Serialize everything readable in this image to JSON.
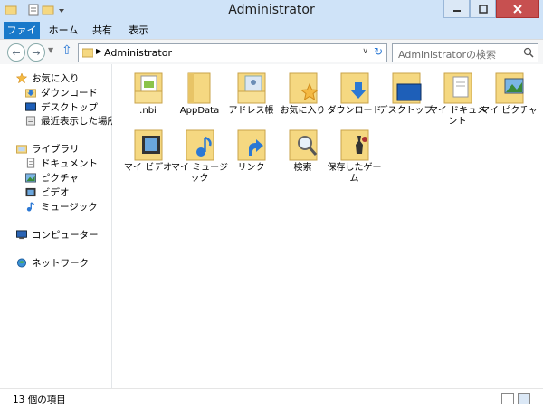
{
  "window": {
    "title": "Administrator"
  },
  "ribbon": {
    "tabs": [
      {
        "label": "ファイル"
      },
      {
        "label": "ホーム"
      },
      {
        "label": "共有"
      },
      {
        "label": "表示"
      }
    ]
  },
  "address": {
    "path": "Administrator"
  },
  "search": {
    "placeholder": "Administratorの検索"
  },
  "nav": {
    "favorites": {
      "label": "お気に入り",
      "items": [
        "ダウンロード",
        "デスクトップ",
        "最近表示した場所"
      ]
    },
    "libraries": {
      "label": "ライブラリ",
      "items": [
        "ドキュメント",
        "ピクチャ",
        "ビデオ",
        "ミュージック"
      ]
    },
    "computer": "コンピューター",
    "network": "ネットワーク"
  },
  "folders": [
    {
      "label": ".nbi",
      "icon": "folder-doc-icon"
    },
    {
      "label": "AppData",
      "icon": "folder-plain-icon"
    },
    {
      "label": "アドレス帳",
      "icon": "folder-contacts-icon"
    },
    {
      "label": "お気に入り",
      "icon": "folder-star-icon"
    },
    {
      "label": "ダウンロード",
      "icon": "folder-download-icon"
    },
    {
      "label": "デスクトップ",
      "icon": "folder-desktop-icon"
    },
    {
      "label": "マイ ドキュメント",
      "icon": "folder-documents-icon"
    },
    {
      "label": "マイ ピクチャ",
      "icon": "folder-pictures-icon"
    },
    {
      "label": "マイ ビデオ",
      "icon": "folder-video-icon"
    },
    {
      "label": "マイ ミュージック",
      "icon": "folder-music-icon"
    },
    {
      "label": "リンク",
      "icon": "folder-link-icon"
    },
    {
      "label": "検索",
      "icon": "folder-search-icon"
    },
    {
      "label": "保存したゲーム",
      "icon": "folder-games-icon"
    }
  ],
  "status": {
    "count_text": "13 個の項目"
  },
  "colors": {
    "accent": "#1979ca",
    "folder": "#f5d881",
    "frame": "#cfe3f8"
  }
}
